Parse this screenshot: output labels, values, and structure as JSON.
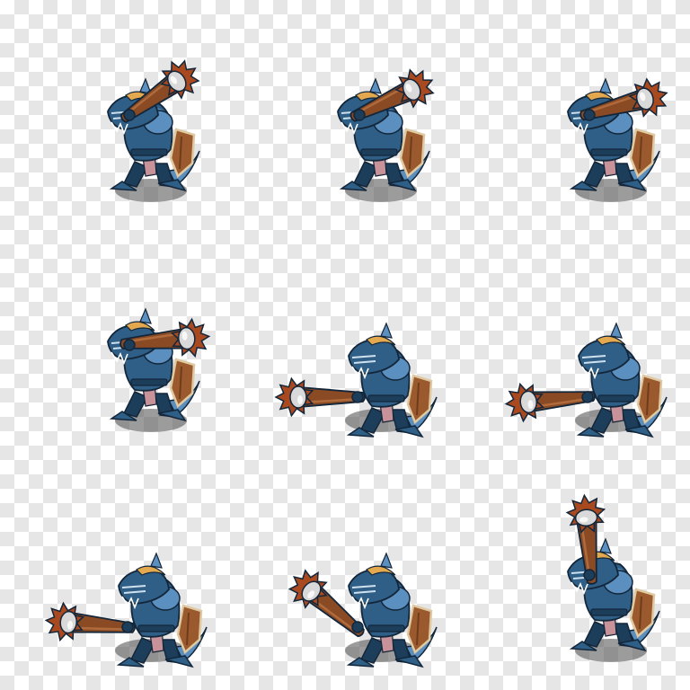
{
  "sprite_sheet": {
    "grid": {
      "columns": 3,
      "rows": 3
    },
    "colors": {
      "armor": "#2f5f86",
      "armor_light": "#5a8fbf",
      "armor_dark": "#1d3e5b",
      "fur": "#e4a94e",
      "club": "#8a4a24",
      "club_dark": "#5c2f15",
      "spikes": "#a8491f",
      "shield": "#9a5a2e",
      "shield_rim": "#e0c9a0",
      "cloth": "#c8929a",
      "shadow": "#4a4a4a",
      "outline": "#13263a",
      "checker_light": "#ffffff",
      "checker_dark": "#e6e6e6"
    },
    "frames": [
      {
        "pose": "club-raised-shoulder",
        "club_angle_deg": -35,
        "crouch": 0
      },
      {
        "pose": "club-raised-shoulder",
        "club_angle_deg": -25,
        "crouch": 0
      },
      {
        "pose": "club-raised-back",
        "club_angle_deg": -15,
        "crouch": 0
      },
      {
        "pose": "club-overhead",
        "club_angle_deg": -5,
        "crouch": 0
      },
      {
        "pose": "club-swing-low",
        "club_angle_deg": 180,
        "crouch": 1
      },
      {
        "pose": "club-swing-low",
        "club_angle_deg": 175,
        "crouch": 1
      },
      {
        "pose": "club-swing-ground",
        "club_angle_deg": 185,
        "crouch": 1
      },
      {
        "pose": "club-swing-rise",
        "club_angle_deg": -140,
        "crouch": 1
      },
      {
        "pose": "club-upright",
        "club_angle_deg": -95,
        "crouch": 0
      }
    ]
  }
}
